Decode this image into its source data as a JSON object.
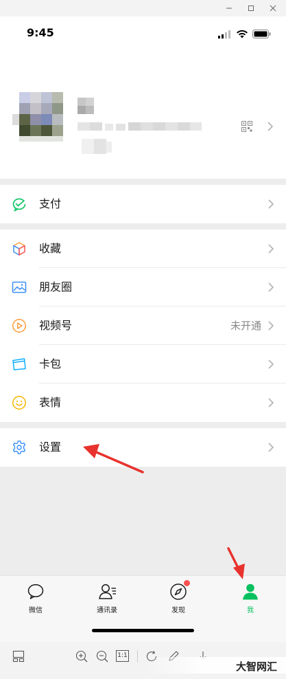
{
  "window": {
    "controls": [
      "minimize-icon",
      "maximize-icon",
      "close-icon"
    ]
  },
  "status_bar": {
    "time": "9:45",
    "icons": [
      "signal-icon",
      "wifi-icon",
      "battery-icon"
    ]
  },
  "profile": {
    "nickname": "",
    "wechat_id": "",
    "icons": [
      "qr-code-icon",
      "chevron-right-icon"
    ]
  },
  "menu": {
    "pay": {
      "label": "支付",
      "icon": "wechat-pay-icon"
    },
    "favorites": {
      "label": "收藏",
      "icon": "cube-icon"
    },
    "moments": {
      "label": "朋友圈",
      "icon": "image-icon"
    },
    "channels": {
      "label": "视频号",
      "value": "未开通",
      "icon": "play-icon"
    },
    "cards": {
      "label": "卡包",
      "icon": "card-icon"
    },
    "stickers": {
      "label": "表情",
      "icon": "smiley-icon"
    },
    "settings": {
      "label": "设置",
      "icon": "gear-icon"
    }
  },
  "tabbar": {
    "chats": "微信",
    "contacts": "通讯录",
    "discover": "发现",
    "me": "我",
    "active": "me",
    "active_color": "#07c160"
  },
  "viewer_toolbar": {
    "zoom_ratio": "1:1",
    "icons": [
      "thumbnail-icon",
      "zoom-in-icon",
      "zoom-out-icon",
      "actual-size-icon",
      "rotate-icon",
      "edit-icon",
      "download-icon"
    ]
  },
  "watermark": "大智网汇",
  "annotation_color": "#e8322e"
}
